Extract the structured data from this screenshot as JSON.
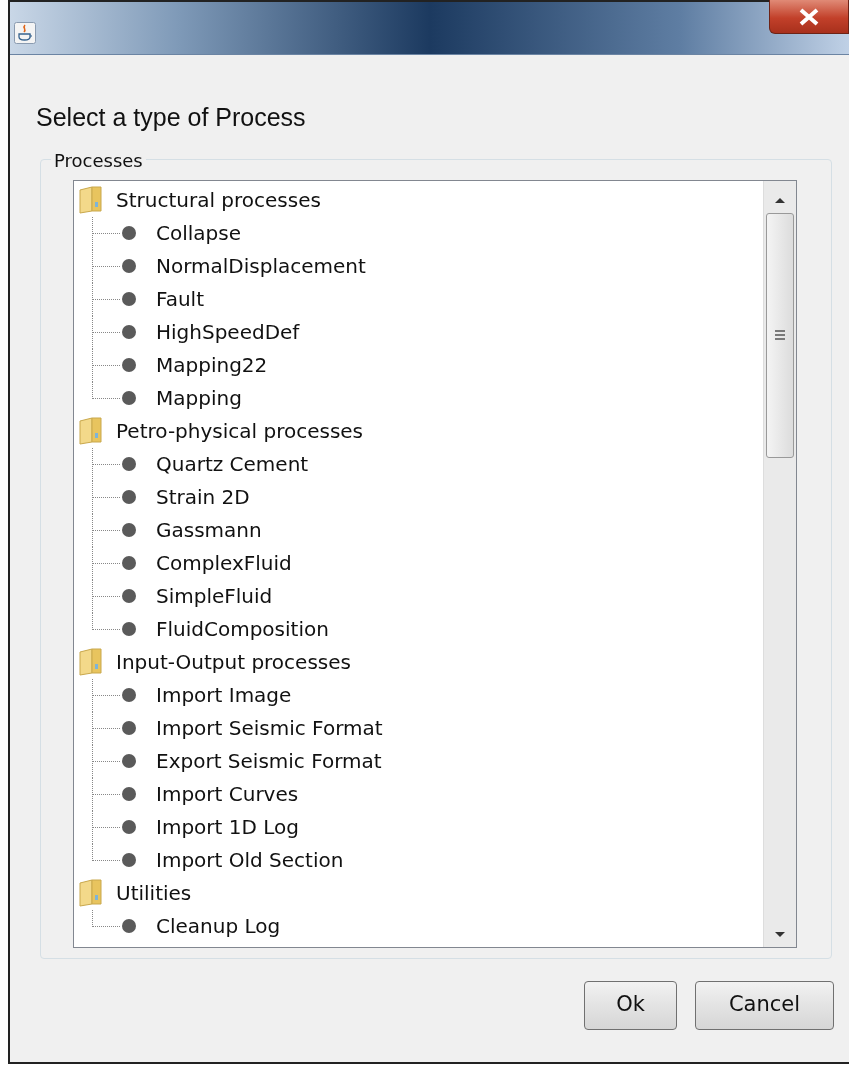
{
  "dialog": {
    "heading": "Select a type of Process"
  },
  "processes": {
    "legend": "Processes",
    "tree": [
      {
        "label": "Structural processes",
        "children": [
          {
            "label": "Collapse"
          },
          {
            "label": "NormalDisplacement"
          },
          {
            "label": "Fault"
          },
          {
            "label": "HighSpeedDef"
          },
          {
            "label": "Mapping22"
          },
          {
            "label": "Mapping"
          }
        ]
      },
      {
        "label": "Petro-physical processes",
        "children": [
          {
            "label": "Quartz Cement"
          },
          {
            "label": "Strain 2D"
          },
          {
            "label": "Gassmann"
          },
          {
            "label": "ComplexFluid"
          },
          {
            "label": "SimpleFluid"
          },
          {
            "label": "FluidComposition"
          }
        ]
      },
      {
        "label": "Input-Output processes",
        "children": [
          {
            "label": "Import Image"
          },
          {
            "label": "Import Seismic Format"
          },
          {
            "label": "Export Seismic Format"
          },
          {
            "label": "Import Curves"
          },
          {
            "label": "Import 1D Log"
          },
          {
            "label": "Import Old Section"
          }
        ]
      },
      {
        "label": "Utilities",
        "children": [
          {
            "label": "Cleanup Log"
          }
        ]
      }
    ]
  },
  "buttons": [
    "Ok",
    "Cancel"
  ]
}
